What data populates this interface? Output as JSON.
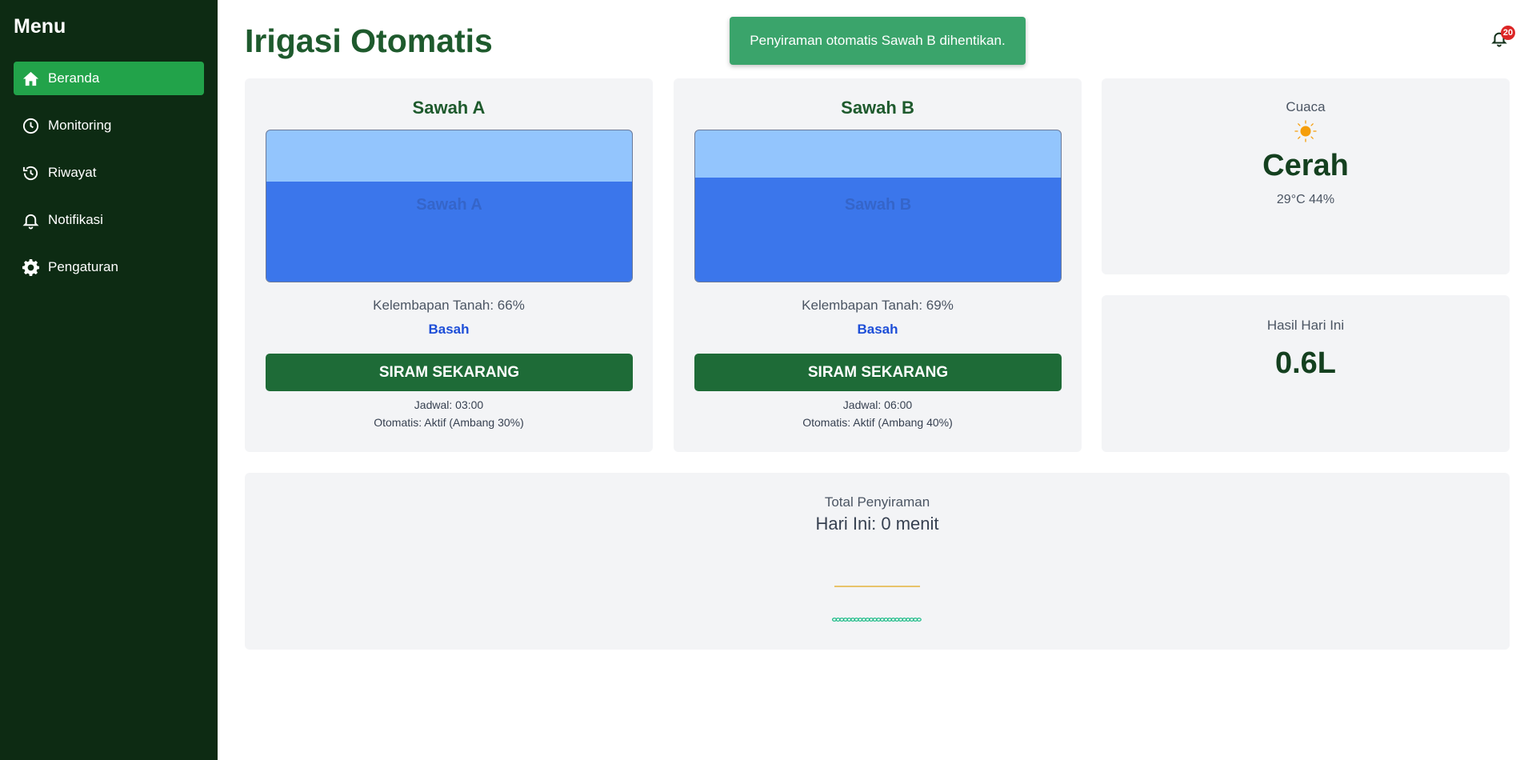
{
  "sidebar": {
    "title": "Menu",
    "items": [
      {
        "label": "Beranda",
        "icon": "home-icon"
      },
      {
        "label": "Monitoring",
        "icon": "clock-icon"
      },
      {
        "label": "Riwayat",
        "icon": "history-icon"
      },
      {
        "label": "Notifikasi",
        "icon": "bell-icon"
      },
      {
        "label": "Pengaturan",
        "icon": "gear-icon"
      }
    ]
  },
  "header": {
    "title": "Irigasi Otomatis",
    "notification_count": "20"
  },
  "toast": {
    "message": "Penyiraman otomatis Sawah B dihentikan."
  },
  "fields": [
    {
      "name": "Sawah A",
      "moisture_text": "Kelembapan Tanah: 66%",
      "moisture_level": 0.66,
      "status": "Basah",
      "button_label": "SIRAM SEKARANG",
      "schedule": "Jadwal: 03:00",
      "auto": "Otomatis: Aktif (Ambang 30%)"
    },
    {
      "name": "Sawah B",
      "moisture_text": "Kelembapan Tanah: 69%",
      "moisture_level": 0.69,
      "status": "Basah",
      "button_label": "SIRAM SEKARANG",
      "schedule": "Jadwal: 06:00",
      "auto": "Otomatis: Aktif (Ambang 40%)"
    }
  ],
  "weather": {
    "label": "Cuaca",
    "icon": "sun-icon",
    "condition": "Cerah",
    "detail": "29°C 44%"
  },
  "yield": {
    "label": "Hasil Hari Ini",
    "value": "0.6L"
  },
  "total": {
    "label": "Total Penyiraman",
    "value": "Hari Ini: 0 menit"
  },
  "colors": {
    "sidebar_bg": "#0d2b13",
    "active_nav": "#22a34a",
    "primary_button": "#1e6b37",
    "toast_bg": "#3aa46b",
    "water_fill": "#3b76eb",
    "water_empty": "#93c5fd",
    "badge": "#dc2626"
  }
}
